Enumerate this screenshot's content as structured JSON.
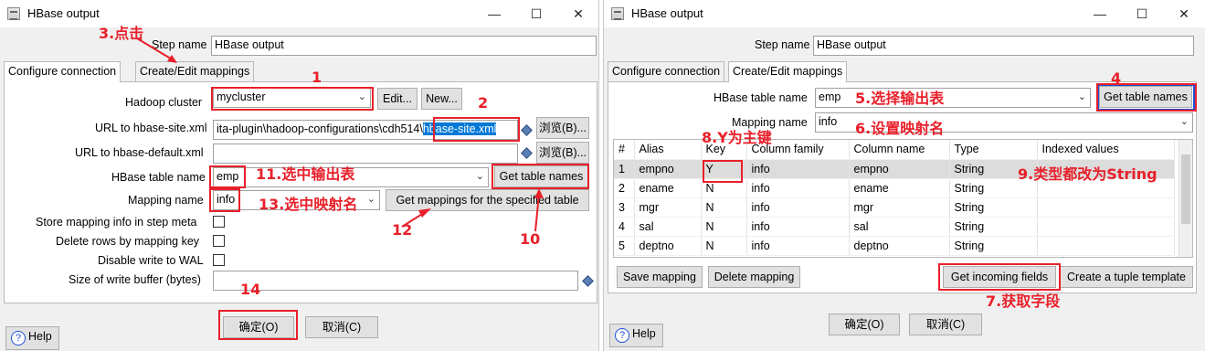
{
  "left_window": {
    "title": "HBase output",
    "step_name_label": "Step name",
    "step_name_value": "HBase output",
    "tabs": [
      "Configure connection",
      "Create/Edit mappings"
    ],
    "hadoop_cluster_label": "Hadoop cluster",
    "hadoop_cluster_value": "mycluster",
    "edit_button": "Edit...",
    "new_button": "New...",
    "url_site_label": "URL to hbase-site.xml",
    "url_site_value_prefix": "ita-plugin\\hadoop-configurations\\cdh514\\",
    "url_site_value_selected": "hbase-site.xml",
    "browse1": "浏览(B)...",
    "url_default_label": "URL to hbase-default.xml",
    "url_default_value": "",
    "browse2": "浏览(B)...",
    "table_name_label": "HBase table name",
    "table_name_value": "emp",
    "get_table_names": "Get table names",
    "mapping_name_label": "Mapping name",
    "mapping_name_value": "info",
    "get_mappings": "Get mappings for the specified table",
    "store_mapping_label": "Store mapping info in step meta",
    "delete_rows_label": "Delete rows by mapping key",
    "disable_wal_label": "Disable write to WAL",
    "buffer_label": "Size of write buffer (bytes)",
    "buffer_value": "",
    "help": "Help",
    "ok": "确定(O)",
    "cancel": "取消(C)"
  },
  "right_window": {
    "title": "HBase output",
    "step_name_label": "Step name",
    "step_name_value": "HBase output",
    "tabs": [
      "Configure connection",
      "Create/Edit mappings"
    ],
    "table_name_label": "HBase table name",
    "table_name_value": "emp",
    "get_table_names": "Get table names",
    "mapping_name_label": "Mapping name",
    "mapping_name_value": "info",
    "columns": [
      "#",
      "Alias",
      "Key",
      "Column family",
      "Column name",
      "Type",
      "Indexed values"
    ],
    "rows": [
      [
        "1",
        "empno",
        "Y",
        "info",
        "empno",
        "String",
        ""
      ],
      [
        "2",
        "ename",
        "N",
        "info",
        "ename",
        "String",
        ""
      ],
      [
        "3",
        "mgr",
        "N",
        "info",
        "mgr",
        "String",
        ""
      ],
      [
        "4",
        "sal",
        "N",
        "info",
        "sal",
        "String",
        ""
      ],
      [
        "5",
        "deptno",
        "N",
        "info",
        "deptno",
        "String",
        ""
      ]
    ],
    "save_mapping": "Save mapping",
    "delete_mapping": "Delete mapping",
    "get_incoming": "Get incoming fields",
    "tuple_template": "Create a tuple template",
    "help": "Help",
    "ok": "确定(O)",
    "cancel": "取消(C)"
  },
  "annotations": {
    "a1": "1",
    "a2": "2",
    "a3": "3.点击",
    "a4": "4",
    "a5": "5.选择输出表",
    "a6": "6.设置映射名",
    "a7": "7.获取字段",
    "a8": "8.Y为主键",
    "a9": "9.类型都改为String",
    "a10": "10",
    "a11": "11.选中输出表",
    "a12": "12",
    "a13": "13.选中映射名",
    "a14": "14"
  },
  "colors": {
    "annotation": "#e8202a",
    "highlight_box": "#1e4fd8",
    "selection": "#0078d7"
  },
  "icons": [
    "hbase-app-icon",
    "minimize-icon",
    "maximize-icon",
    "close-icon",
    "variable-diamond-icon",
    "help-icon",
    "dropdown-arrow-icon"
  ]
}
